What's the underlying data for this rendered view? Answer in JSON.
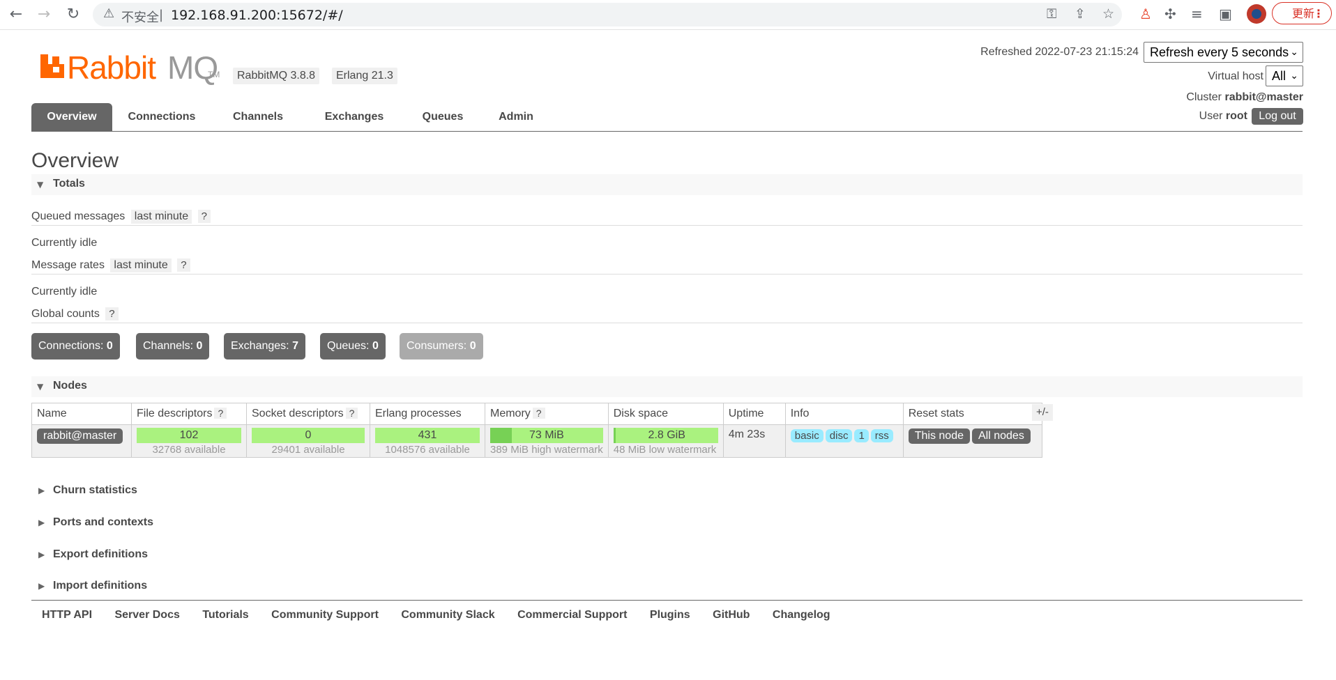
{
  "browser": {
    "security_label": "不安全",
    "url": "192.168.91.200:15672/#/",
    "update_label": "更新"
  },
  "app": {
    "logo_rabbit": "Rabbit",
    "logo_mq": "MQ",
    "logo_tm": "TM",
    "version": "RabbitMQ 3.8.8",
    "erlang": "Erlang 21.3",
    "refreshed": "Refreshed 2022-07-23 21:15:24",
    "refresh_select": "Refresh every 5 seconds",
    "vhost_label": "Virtual host",
    "vhost_select": "All",
    "cluster_label": "Cluster",
    "cluster_value": "rabbit@master",
    "user_label": "User",
    "user_value": "root",
    "logout": "Log out"
  },
  "tabs": [
    {
      "label": "Overview",
      "active": true
    },
    {
      "label": "Connections"
    },
    {
      "label": "Channels"
    },
    {
      "label": "Exchanges"
    },
    {
      "label": "Queues"
    },
    {
      "label": "Admin"
    }
  ],
  "page_title": "Overview",
  "totals": {
    "section": "Totals",
    "queued_label": "Queued messages",
    "queued_range": "last minute",
    "help": "?",
    "idle1": "Currently idle",
    "rates_label": "Message rates",
    "rates_range": "last minute",
    "idle2": "Currently idle",
    "global_label": "Global counts",
    "counts": [
      {
        "label": "Connections:",
        "value": "0"
      },
      {
        "label": "Channels:",
        "value": "0"
      },
      {
        "label": "Exchanges:",
        "value": "7"
      },
      {
        "label": "Queues:",
        "value": "0"
      },
      {
        "label": "Consumers:",
        "value": "0"
      }
    ]
  },
  "nodes": {
    "section": "Nodes",
    "headers": [
      "Name",
      "File descriptors",
      "Socket descriptors",
      "Erlang processes",
      "Memory",
      "Disk space",
      "Uptime",
      "Info",
      "Reset stats"
    ],
    "row": {
      "name": "rabbit@master",
      "fd_used": "102",
      "fd_avail": "32768 available",
      "sd_used": "0",
      "sd_avail": "29401 available",
      "ep_used": "431",
      "ep_avail": "1048576 available",
      "mem_used": "73 MiB",
      "mem_sub": "389 MiB high watermark",
      "mem_fraction": 0.19,
      "disk_free": "2.8 GiB",
      "disk_sub": "48 MiB low watermark",
      "uptime": "4m 23s",
      "info": [
        "basic",
        "disc",
        "1",
        "rss"
      ],
      "reset_this": "This node",
      "reset_all": "All nodes"
    },
    "plusminus": "+/-"
  },
  "collapsed_sections": [
    "Churn statistics",
    "Ports and contexts",
    "Export definitions",
    "Import definitions"
  ],
  "footer": [
    "HTTP API",
    "Server Docs",
    "Tutorials",
    "Community Support",
    "Community Slack",
    "Commercial Support",
    "Plugins",
    "GitHub",
    "Changelog"
  ]
}
